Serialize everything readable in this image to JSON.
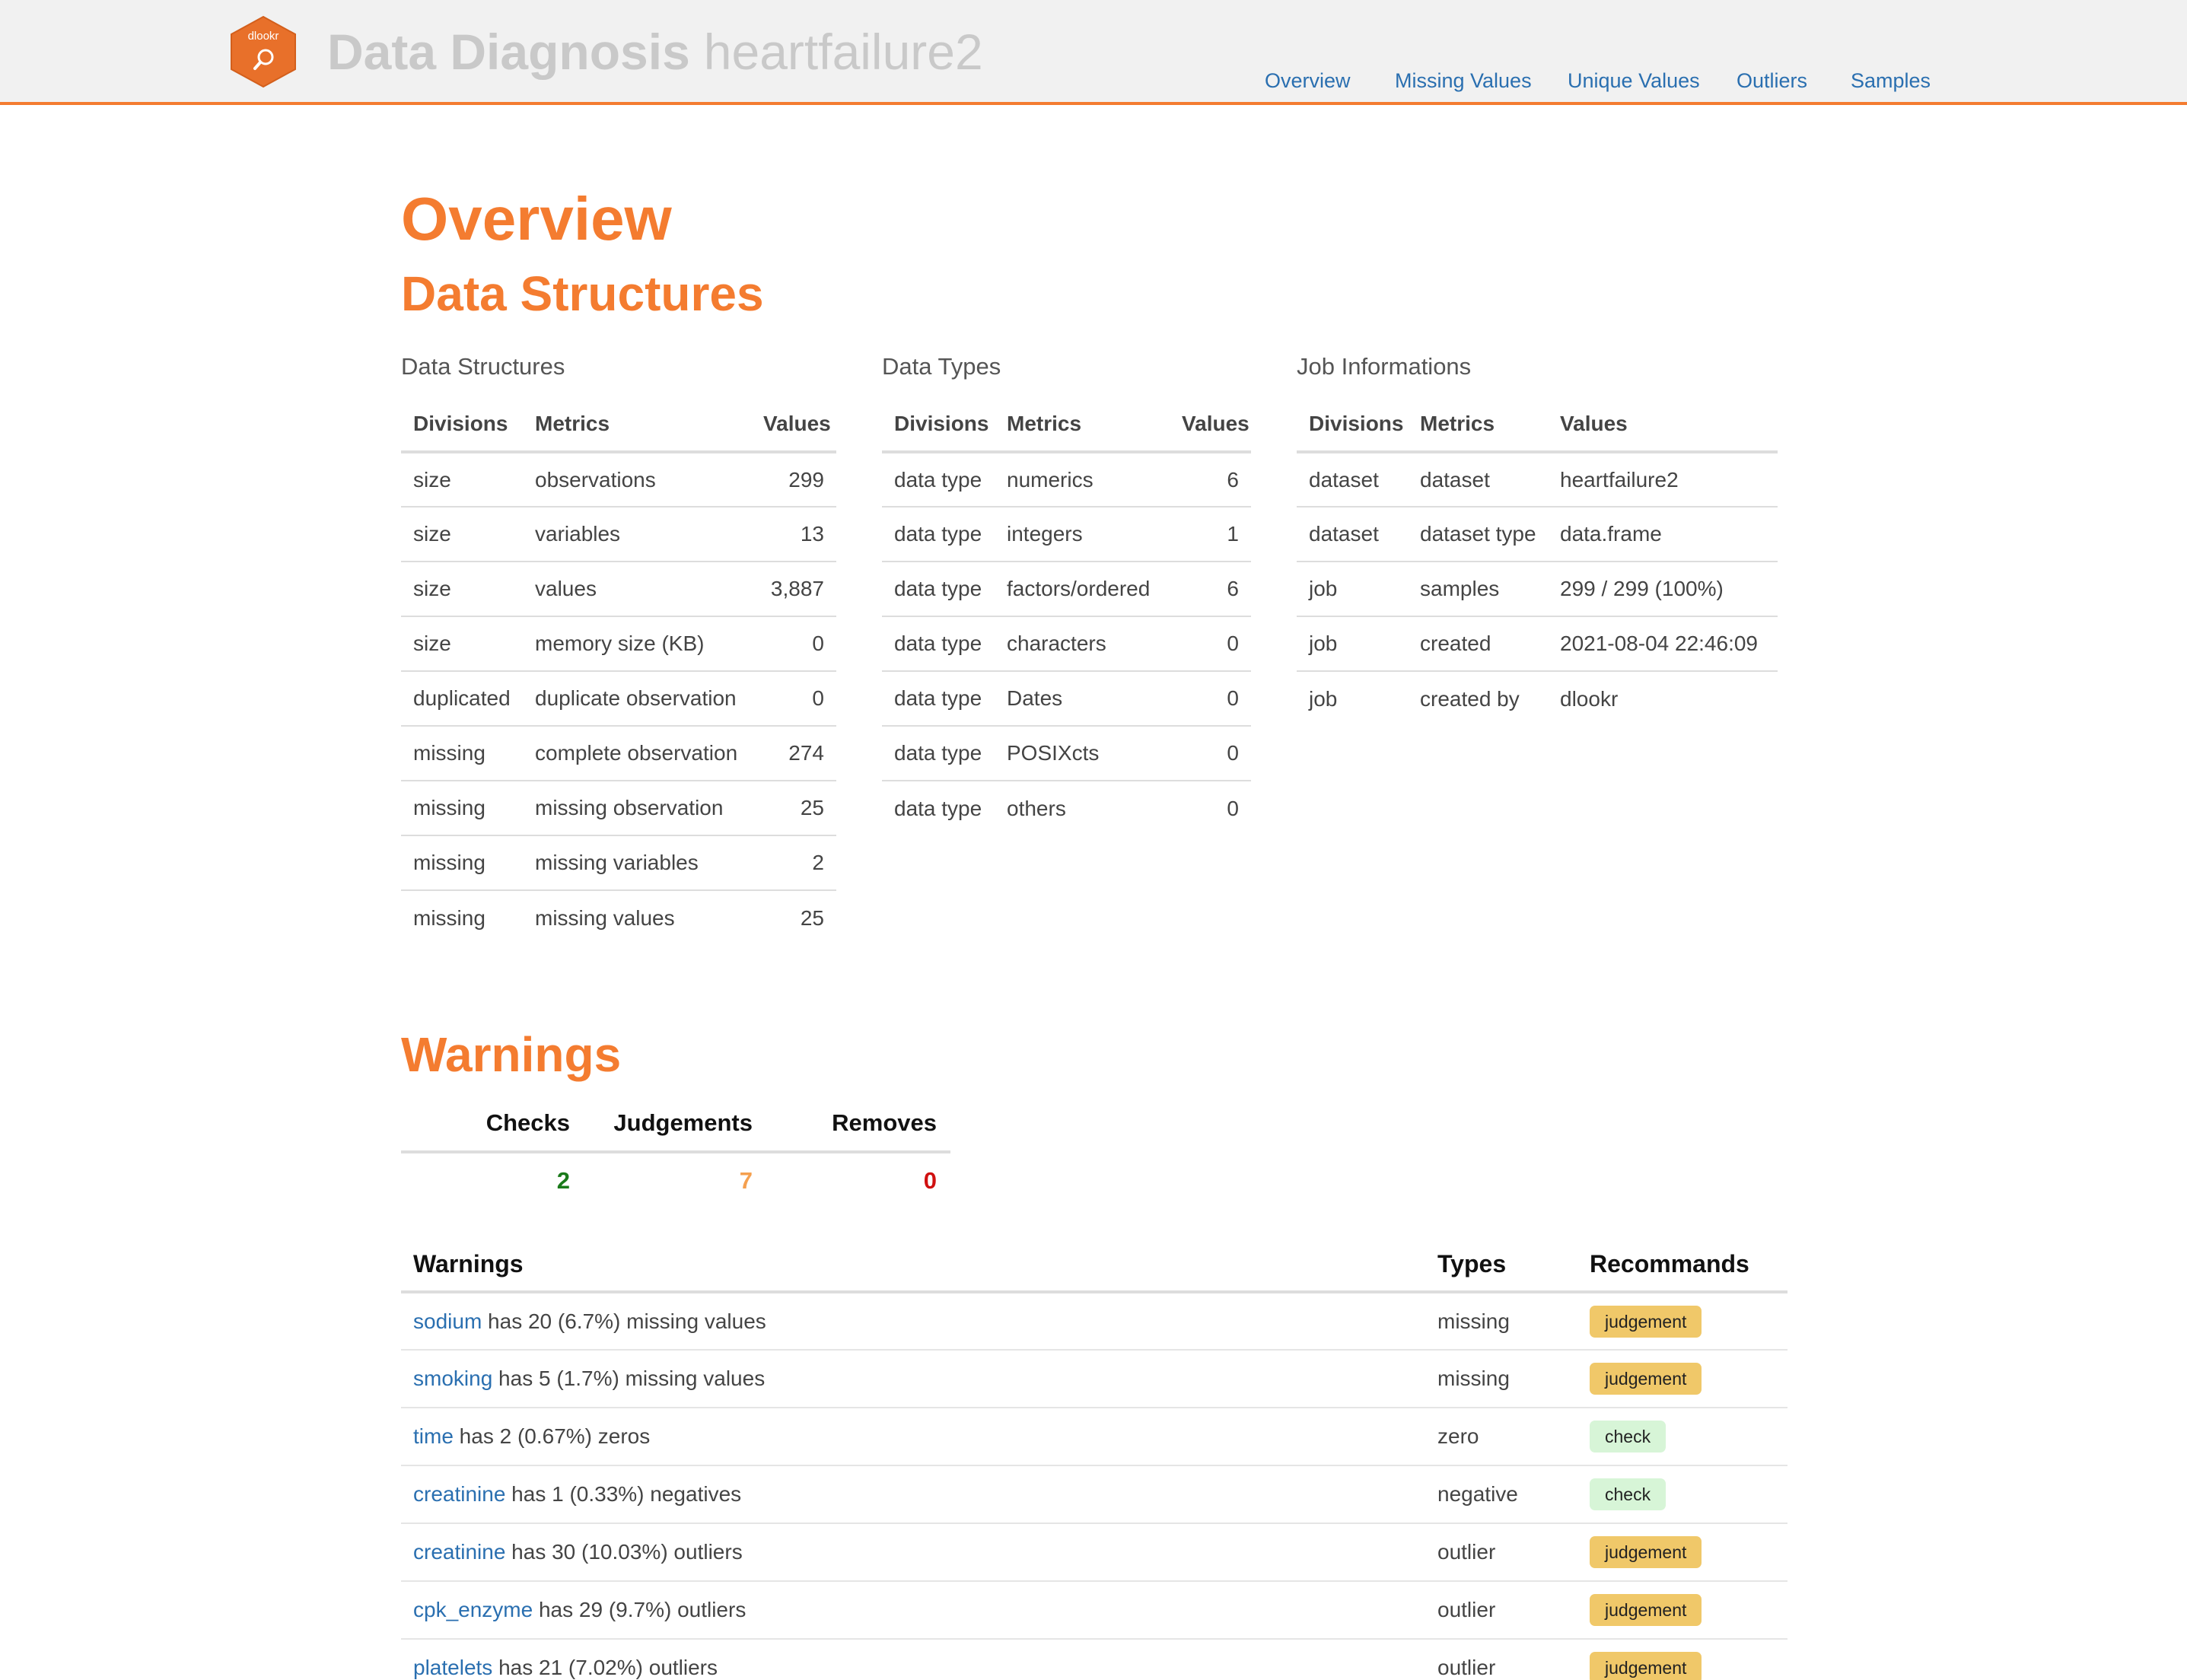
{
  "header": {
    "logo_text": "dlookr",
    "brand_title": "Data Diagnosis",
    "brand_dataset": "heartfailure2",
    "nav": [
      "Overview",
      "Missing Values",
      "Unique Values",
      "Outliers",
      "Samples"
    ]
  },
  "page": {
    "title": "Overview",
    "section_structures": "Data Structures",
    "section_warnings": "Warnings"
  },
  "structures": {
    "caption": "Data Structures",
    "headers": [
      "Divisions",
      "Metrics",
      "Values"
    ],
    "rows": [
      [
        "size",
        "observations",
        "299"
      ],
      [
        "size",
        "variables",
        "13"
      ],
      [
        "size",
        "values",
        "3,887"
      ],
      [
        "size",
        "memory size (KB)",
        "0"
      ],
      [
        "duplicated",
        "duplicate observation",
        "0"
      ],
      [
        "missing",
        "complete observation",
        "274"
      ],
      [
        "missing",
        "missing observation",
        "25"
      ],
      [
        "missing",
        "missing variables",
        "2"
      ],
      [
        "missing",
        "missing values",
        "25"
      ]
    ]
  },
  "types": {
    "caption": "Data Types",
    "headers": [
      "Divisions",
      "Metrics",
      "Values"
    ],
    "rows": [
      [
        "data type",
        "numerics",
        "6"
      ],
      [
        "data type",
        "integers",
        "1"
      ],
      [
        "data type",
        "factors/ordered",
        "6"
      ],
      [
        "data type",
        "characters",
        "0"
      ],
      [
        "data type",
        "Dates",
        "0"
      ],
      [
        "data type",
        "POSIXcts",
        "0"
      ],
      [
        "data type",
        "others",
        "0"
      ]
    ]
  },
  "job": {
    "caption": "Job Informations",
    "headers": [
      "Divisions",
      "Metrics",
      "Values"
    ],
    "rows": [
      [
        "dataset",
        "dataset",
        "heartfailure2"
      ],
      [
        "dataset",
        "dataset type",
        "data.frame"
      ],
      [
        "job",
        "samples",
        "299 / 299 (100%)"
      ],
      [
        "job",
        "created",
        "2021-08-04 22:46:09"
      ],
      [
        "job",
        "created by",
        "dlookr"
      ]
    ]
  },
  "summary": {
    "headers": [
      "Checks",
      "Judgements",
      "Removes"
    ],
    "values": [
      "2",
      "7",
      "0"
    ],
    "colors": [
      "#1a7a1a",
      "#f5a04f",
      "#d01010"
    ]
  },
  "warnings": {
    "headers": [
      "Warnings",
      "Types",
      "Recommands"
    ],
    "rows": [
      {
        "var": "sodium",
        "text": " has 20 (6.7%) missing values",
        "type": "missing",
        "rec": "judgement"
      },
      {
        "var": "smoking",
        "text": " has 5 (1.7%) missing values",
        "type": "missing",
        "rec": "judgement"
      },
      {
        "var": "time",
        "text": " has 2 (0.67%) zeros",
        "type": "zero",
        "rec": "check"
      },
      {
        "var": "creatinine",
        "text": " has 1 (0.33%) negatives",
        "type": "negative",
        "rec": "check"
      },
      {
        "var": "creatinine",
        "text": " has 30 (10.03%) outliers",
        "type": "outlier",
        "rec": "judgement"
      },
      {
        "var": "cpk_enzyme",
        "text": " has 29 (9.7%) outliers",
        "type": "outlier",
        "rec": "judgement"
      },
      {
        "var": "platelets",
        "text": " has 21 (7.02%) outliers",
        "type": "outlier",
        "rec": "judgement"
      }
    ]
  },
  "colors": {
    "accent": "#f47c30",
    "link": "#2a6fb0",
    "judgement_badge": "#f0c869",
    "check_badge": "#d7f5d7"
  }
}
